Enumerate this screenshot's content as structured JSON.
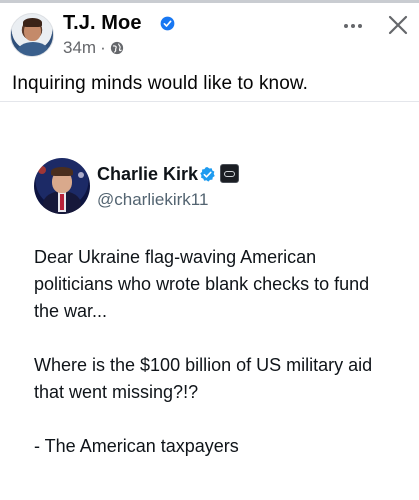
{
  "post": {
    "author": "T.J. Moe",
    "time": "34m",
    "separator": "·",
    "text": "Inquiring minds would like to know.",
    "verified_icon": "verified-badge-icon",
    "audience_icon": "globe-icon",
    "more_icon": "ellipsis-icon",
    "close_icon": "close-x-icon"
  },
  "embedded_tweet": {
    "name": "Charlie Kirk",
    "handle": "@charliekirk11",
    "verified_icon": "verified-badge-icon",
    "affiliation_icon": "affiliation-badge-icon",
    "paragraphs": [
      "Dear Ukraine flag-waving American politicians who wrote blank checks to fund the war...",
      "Where is the $100 billion of US military aid that went missing?!?",
      "- The American taxpayers"
    ]
  },
  "colors": {
    "verified_blue": "#1d9bf0",
    "facebook_verified": "#1877f2",
    "secondary_text": "#65676b",
    "handle_gray": "#536471"
  }
}
